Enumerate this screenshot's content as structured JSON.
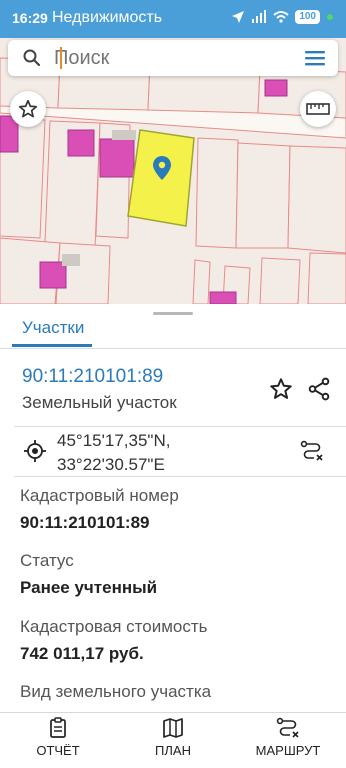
{
  "status_bar": {
    "time": "16:29",
    "app_name": "Недвижимость",
    "battery": "100"
  },
  "search": {
    "placeholder": "Поиск"
  },
  "map": {
    "parcel_fill": "#f4f24a",
    "building_color": "#d94fb5",
    "boundary_color": "#e88a8a"
  },
  "sheet": {
    "tab_label": "Участки",
    "parcel": {
      "number": "90:11:210101:89",
      "type": "Земельный участок"
    },
    "coordinates": {
      "lat": "45°15'17,35\"N,",
      "lon": "33°22'30.57\"E"
    },
    "fields": {
      "cadastral_label": "Кадастровый номер",
      "cadastral_value": "90:11:210101:89",
      "status_label": "Статус",
      "status_value": "Ранее учтенный",
      "cost_label": "Кадастровая стоимость",
      "cost_value": "742 011,17 руб.",
      "land_kind_label": "Вид земельного участка"
    }
  },
  "bottom_nav": {
    "report": "ОТЧЁТ",
    "plan": "ПЛАН",
    "route": "МАРШРУТ"
  },
  "colors": {
    "accent": "#2b7bb9",
    "status_bar": "#4a9fd8"
  }
}
